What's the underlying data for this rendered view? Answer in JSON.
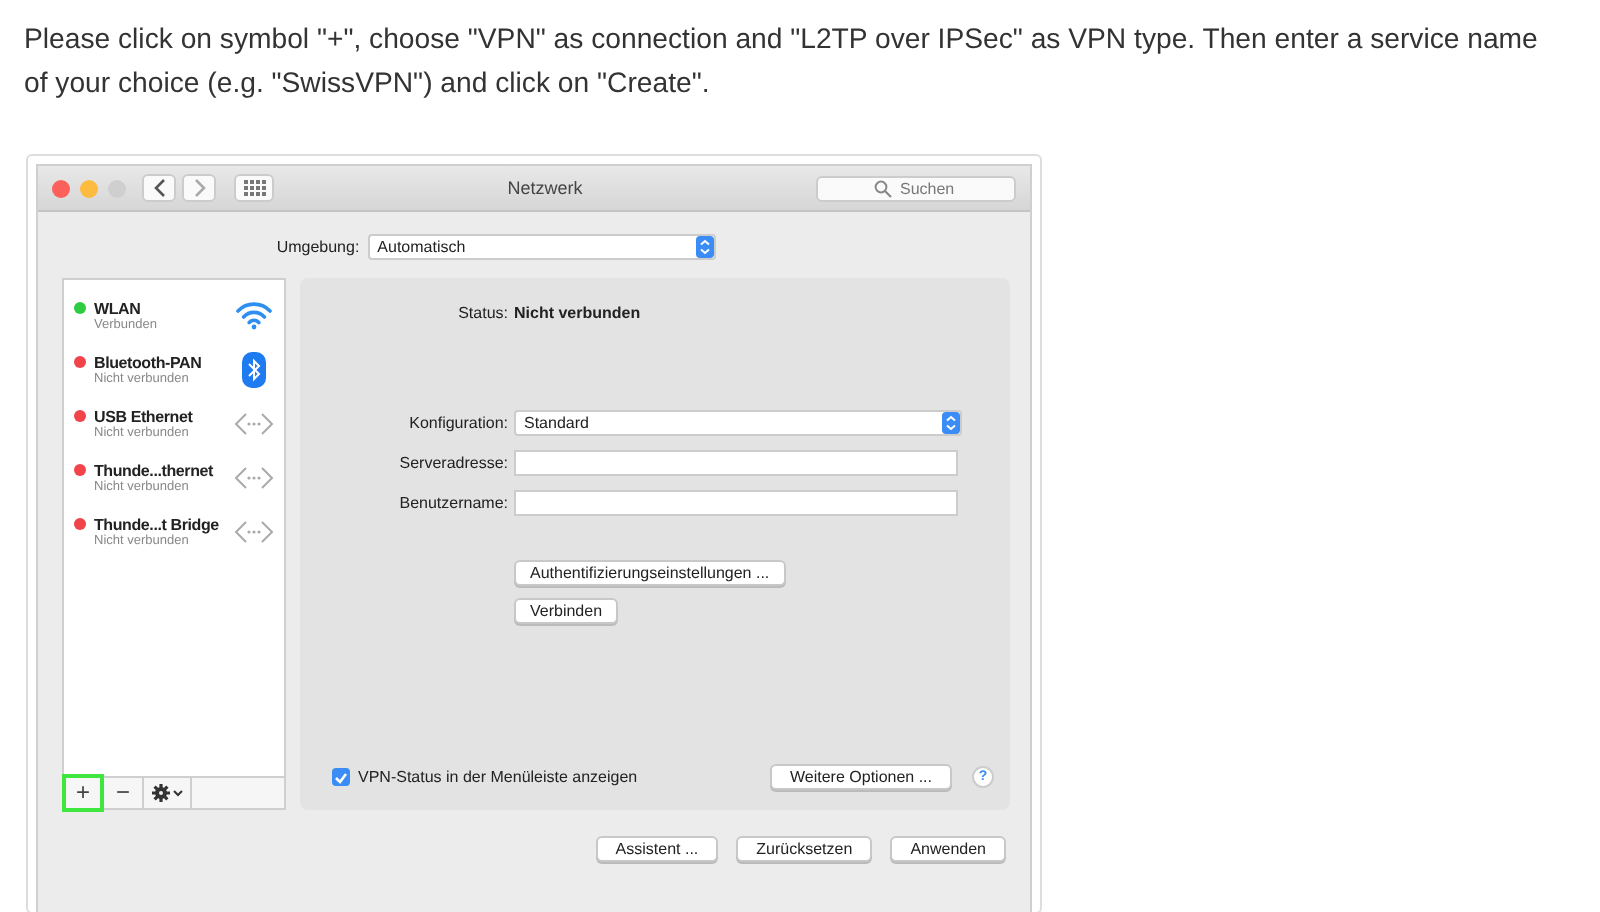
{
  "instruction": "Please click on symbol \"+\", choose \"VPN\" as connection and \"L2TP over IPSec\" as VPN type. Then enter a service name of your choice (e.g. \"SwissVPN\") and click on \"Create\".",
  "window": {
    "title": "Netzwerk",
    "search": {
      "placeholder": "Suchen"
    }
  },
  "location": {
    "label": "Umgebung:",
    "value": "Automatisch"
  },
  "services": [
    {
      "name": "WLAN",
      "status": "Verbunden",
      "color": "#2ecc40",
      "kind": "wifi"
    },
    {
      "name": "Bluetooth-PAN",
      "status": "Nicht verbunden",
      "color": "#f0434a",
      "kind": "bluetooth"
    },
    {
      "name": "USB Ethernet",
      "status": "Nicht verbunden",
      "color": "#f0434a",
      "kind": "ethernet"
    },
    {
      "name": "Thunde...thernet",
      "status": "Nicht verbunden",
      "color": "#f0434a",
      "kind": "ethernet"
    },
    {
      "name": "Thunde...t Bridge",
      "status": "Nicht verbunden",
      "color": "#f0434a",
      "kind": "ethernet"
    }
  ],
  "service_toolbar": {
    "add": {
      "label": "+",
      "highlighted": true
    },
    "remove": {
      "label": "−",
      "highlighted": false
    }
  },
  "detail": {
    "status_label": "Status:",
    "status_value": "Nicht verbunden",
    "fields": [
      {
        "label": "Konfiguration:",
        "kind": "popup",
        "value": "Standard"
      },
      {
        "label": "Serveradresse:",
        "kind": "text"
      },
      {
        "label": "Benutzername:",
        "kind": "text"
      }
    ],
    "buttons": [
      "Authentifizierungseinstellungen ...",
      "Verbinden"
    ],
    "menu_checkbox": {
      "label": "VPN-Status in der Menüleiste anzeigen",
      "checked": true
    },
    "more_button": "Weitere Optionen ...",
    "help": "?"
  },
  "footer_buttons": [
    "Assistent ...",
    "Zurücksetzen",
    "Anwenden"
  ]
}
